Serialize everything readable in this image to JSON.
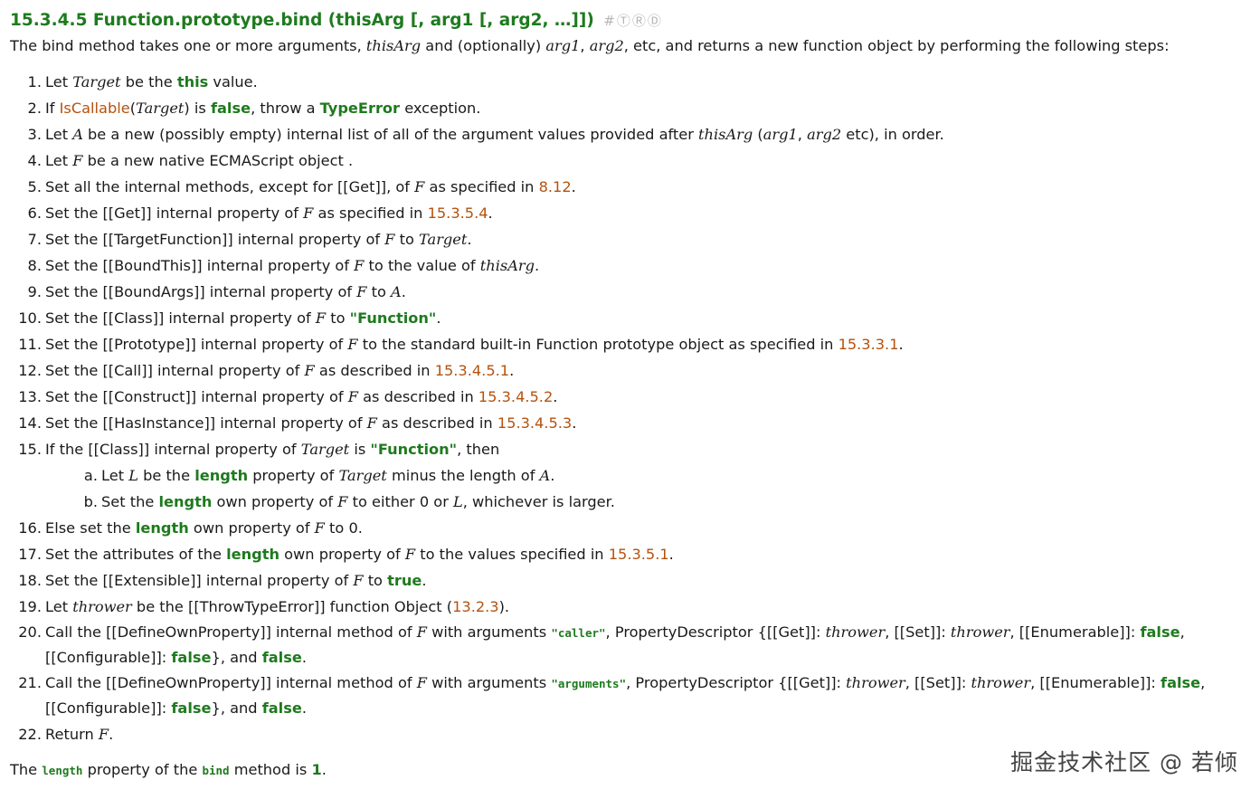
{
  "heading": {
    "title": "15.3.4.5 Function.prototype.bind (thisArg [, arg1 [, arg2, …]])",
    "marks": [
      "#",
      "Ⓣ",
      "Ⓡ",
      "Ⓓ"
    ]
  },
  "intro": [
    {
      "t": "The bind method takes one or more arguments, "
    },
    {
      "t": "thisArg",
      "c": "v"
    },
    {
      "t": " and (optionally) "
    },
    {
      "t": "arg1",
      "c": "v"
    },
    {
      "t": ", "
    },
    {
      "t": "arg2",
      "c": "v"
    },
    {
      "t": ", etc, and returns a new function object by performing the following steps:"
    }
  ],
  "steps": [
    {
      "num": "1.",
      "parts": [
        {
          "t": "Let "
        },
        {
          "t": "Target",
          "c": "v"
        },
        {
          "t": " be the "
        },
        {
          "t": "this",
          "c": "kw"
        },
        {
          "t": " value."
        }
      ]
    },
    {
      "num": "2.",
      "parts": [
        {
          "t": "If "
        },
        {
          "t": "IsCallable",
          "c": "ref"
        },
        {
          "t": "("
        },
        {
          "t": "Target",
          "c": "v"
        },
        {
          "t": ") is "
        },
        {
          "t": "false",
          "c": "kw"
        },
        {
          "t": ", throw a "
        },
        {
          "t": "TypeError",
          "c": "kw"
        },
        {
          "t": " exception."
        }
      ]
    },
    {
      "num": "3.",
      "parts": [
        {
          "t": "Let "
        },
        {
          "t": "A",
          "c": "v"
        },
        {
          "t": " be a new (possibly empty) internal list of all of the argument values provided after "
        },
        {
          "t": "thisArg",
          "c": "v"
        },
        {
          "t": " ("
        },
        {
          "t": "arg1",
          "c": "v"
        },
        {
          "t": ", "
        },
        {
          "t": "arg2",
          "c": "v"
        },
        {
          "t": " etc), in order."
        }
      ]
    },
    {
      "num": "4.",
      "parts": [
        {
          "t": "Let "
        },
        {
          "t": "F",
          "c": "v"
        },
        {
          "t": " be a new native ECMAScript object ."
        }
      ]
    },
    {
      "num": "5.",
      "parts": [
        {
          "t": "Set all the internal methods, except for [[Get]], of "
        },
        {
          "t": "F",
          "c": "v"
        },
        {
          "t": " as specified in "
        },
        {
          "t": "8.12",
          "c": "ref"
        },
        {
          "t": "."
        }
      ]
    },
    {
      "num": "6.",
      "parts": [
        {
          "t": "Set the [[Get]] internal property of "
        },
        {
          "t": "F",
          "c": "v"
        },
        {
          "t": " as specified in "
        },
        {
          "t": "15.3.5.4",
          "c": "ref"
        },
        {
          "t": "."
        }
      ]
    },
    {
      "num": "7.",
      "parts": [
        {
          "t": "Set the [[TargetFunction]] internal property of "
        },
        {
          "t": "F",
          "c": "v"
        },
        {
          "t": " to "
        },
        {
          "t": "Target",
          "c": "v"
        },
        {
          "t": "."
        }
      ]
    },
    {
      "num": "8.",
      "parts": [
        {
          "t": "Set the [[BoundThis]] internal property of "
        },
        {
          "t": "F",
          "c": "v"
        },
        {
          "t": " to the value of "
        },
        {
          "t": "thisArg",
          "c": "v"
        },
        {
          "t": "."
        }
      ]
    },
    {
      "num": "9.",
      "parts": [
        {
          "t": "Set the [[BoundArgs]] internal property of "
        },
        {
          "t": "F",
          "c": "v"
        },
        {
          "t": " to "
        },
        {
          "t": "A",
          "c": "v"
        },
        {
          "t": "."
        }
      ]
    },
    {
      "num": "10.",
      "parts": [
        {
          "t": "Set the [[Class]] internal property of "
        },
        {
          "t": "F",
          "c": "v"
        },
        {
          "t": " to "
        },
        {
          "t": "\"Function\"",
          "c": "kw"
        },
        {
          "t": "."
        }
      ]
    },
    {
      "num": "11.",
      "parts": [
        {
          "t": "Set the [[Prototype]] internal property of "
        },
        {
          "t": "F",
          "c": "v"
        },
        {
          "t": " to the standard built-in Function prototype object as specified in "
        },
        {
          "t": "15.3.3.1",
          "c": "ref"
        },
        {
          "t": "."
        }
      ]
    },
    {
      "num": "12.",
      "parts": [
        {
          "t": "Set the [[Call]] internal property of "
        },
        {
          "t": "F",
          "c": "v"
        },
        {
          "t": " as described in "
        },
        {
          "t": "15.3.4.5.1",
          "c": "ref"
        },
        {
          "t": "."
        }
      ]
    },
    {
      "num": "13.",
      "parts": [
        {
          "t": "Set the [[Construct]] internal property of "
        },
        {
          "t": "F",
          "c": "v"
        },
        {
          "t": " as described in "
        },
        {
          "t": "15.3.4.5.2",
          "c": "ref"
        },
        {
          "t": "."
        }
      ]
    },
    {
      "num": "14.",
      "parts": [
        {
          "t": "Set the [[HasInstance]] internal property of "
        },
        {
          "t": "F",
          "c": "v"
        },
        {
          "t": " as described in "
        },
        {
          "t": "15.3.4.5.3",
          "c": "ref"
        },
        {
          "t": "."
        }
      ]
    },
    {
      "num": "15.",
      "parts": [
        {
          "t": "If the [[Class]] internal property of "
        },
        {
          "t": "Target",
          "c": "v"
        },
        {
          "t": " is "
        },
        {
          "t": "\"Function\"",
          "c": "kw"
        },
        {
          "t": ", then"
        }
      ],
      "sub": [
        {
          "num": "a.",
          "parts": [
            {
              "t": "Let "
            },
            {
              "t": "L",
              "c": "v"
            },
            {
              "t": " be the "
            },
            {
              "t": "length",
              "c": "kw"
            },
            {
              "t": " property of "
            },
            {
              "t": "Target",
              "c": "v"
            },
            {
              "t": " minus the length of "
            },
            {
              "t": "A",
              "c": "v"
            },
            {
              "t": "."
            }
          ]
        },
        {
          "num": "b.",
          "parts": [
            {
              "t": "Set the "
            },
            {
              "t": "length",
              "c": "kw"
            },
            {
              "t": " own property of "
            },
            {
              "t": "F",
              "c": "v"
            },
            {
              "t": " to either 0 or "
            },
            {
              "t": "L",
              "c": "v"
            },
            {
              "t": ", whichever is larger."
            }
          ]
        }
      ]
    },
    {
      "num": "16.",
      "parts": [
        {
          "t": "Else set the "
        },
        {
          "t": "length",
          "c": "kw"
        },
        {
          "t": " own property of "
        },
        {
          "t": "F",
          "c": "v"
        },
        {
          "t": " to 0."
        }
      ]
    },
    {
      "num": "17.",
      "parts": [
        {
          "t": "Set the attributes of the "
        },
        {
          "t": "length",
          "c": "kw"
        },
        {
          "t": " own property of "
        },
        {
          "t": "F",
          "c": "v"
        },
        {
          "t": " to the values specified in "
        },
        {
          "t": "15.3.5.1",
          "c": "ref"
        },
        {
          "t": "."
        }
      ]
    },
    {
      "num": "18.",
      "parts": [
        {
          "t": "Set the [[Extensible]] internal property of "
        },
        {
          "t": "F",
          "c": "v"
        },
        {
          "t": " to "
        },
        {
          "t": "true",
          "c": "kw"
        },
        {
          "t": "."
        }
      ]
    },
    {
      "num": "19.",
      "parts": [
        {
          "t": "Let "
        },
        {
          "t": "thrower",
          "c": "v"
        },
        {
          "t": " be the [[ThrowTypeError]] function Object ("
        },
        {
          "t": "13.2.3",
          "c": "ref"
        },
        {
          "t": ")."
        }
      ]
    },
    {
      "num": "20.",
      "wrap": true,
      "parts": [
        {
          "t": "Call the [[DefineOwnProperty]] internal method of "
        },
        {
          "t": "F",
          "c": "v"
        },
        {
          "t": " with arguments "
        },
        {
          "t": "\"caller\"",
          "c": "code"
        },
        {
          "t": ", PropertyDescriptor {[[Get]]: "
        },
        {
          "t": "thrower",
          "c": "v"
        },
        {
          "t": ", [[Set]]: "
        },
        {
          "t": "thrower",
          "c": "v"
        },
        {
          "t": ", [[Enumerable]]: "
        },
        {
          "t": "false",
          "c": "kw"
        },
        {
          "t": ", [[Configurable]]: "
        },
        {
          "t": "false",
          "c": "kw"
        },
        {
          "t": "}, and "
        },
        {
          "t": "false",
          "c": "kw"
        },
        {
          "t": "."
        }
      ]
    },
    {
      "num": "21.",
      "wrap": true,
      "parts": [
        {
          "t": "Call the [[DefineOwnProperty]] internal method of "
        },
        {
          "t": "F",
          "c": "v"
        },
        {
          "t": " with arguments "
        },
        {
          "t": "\"arguments\"",
          "c": "code"
        },
        {
          "t": ", PropertyDescriptor {[[Get]]: "
        },
        {
          "t": "thrower",
          "c": "v"
        },
        {
          "t": ", [[Set]]: "
        },
        {
          "t": "thrower",
          "c": "v"
        },
        {
          "t": ", [[Enumerable]]: "
        },
        {
          "t": "false",
          "c": "kw"
        },
        {
          "t": ", [[Configurable]]: "
        },
        {
          "t": "false",
          "c": "kw"
        },
        {
          "t": "}, and "
        },
        {
          "t": "false",
          "c": "kw"
        },
        {
          "t": "."
        }
      ]
    },
    {
      "num": "22.",
      "parts": [
        {
          "t": "Return "
        },
        {
          "t": "F",
          "c": "v"
        },
        {
          "t": "."
        }
      ]
    }
  ],
  "outro": [
    {
      "t": "The "
    },
    {
      "t": "length",
      "c": "code"
    },
    {
      "t": " property of the "
    },
    {
      "t": "bind",
      "c": "code"
    },
    {
      "t": " method is "
    },
    {
      "t": "1",
      "c": "kw"
    },
    {
      "t": "."
    }
  ],
  "watermark": "掘金技术社区 @ 若倾",
  "colors": {
    "keyword": "#1e7a1e",
    "reference": "#b4520e",
    "text": "#1a1a1a",
    "marks": "#b5b5b5"
  }
}
